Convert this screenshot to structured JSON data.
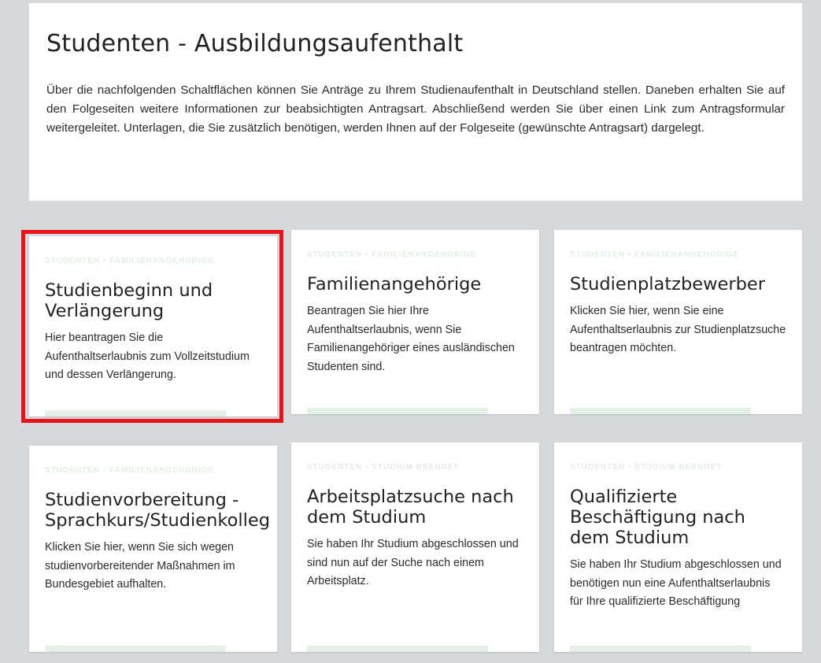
{
  "page": {
    "title": "Studenten - Ausbildungsaufenthalt",
    "intro": "Über die nachfolgenden Schaltflächen können Sie Anträge zu Ihrem Studienaufenthalt in Deutschland stellen. Daneben erhalten Sie auf den Folgeseiten weitere Informationen zur beabsichtigten Antragsart. Abschließend werden Sie über einen Link zum Antragsformular weitergeleitet. Unterlagen, die Sie zusätzlich benötigen, werden Ihnen auf der Folgeseite (gewünschte Antragsart) dargelegt."
  },
  "colors": {
    "page_background": "#d6d9dc",
    "card_background": "#ffffff",
    "highlight_border": "#e8141a",
    "card_accent": "#e6f1e6"
  },
  "cards": [
    {
      "category": "STUDENTEN • FAMILIENANGEHÖRIGE",
      "title": "Studienbeginn und Verlängerung",
      "text": "Hier beantragen Sie die Aufenthaltserlaubnis zum Vollzeitstudium und dessen Verlängerung.",
      "highlighted": true
    },
    {
      "category": "STUDENTEN • FAMILIENANGEHÖRIGE",
      "title": "Familienangehörige",
      "text": "Beantragen Sie hier Ihre Aufenthaltserlaubnis, wenn Sie Familienangehöriger eines ausländischen Studenten sind.",
      "highlighted": false
    },
    {
      "category": "STUDENTEN • FAMILIENANGEHÖRIGE",
      "title": "Studienplatzbewerber",
      "text": "Klicken Sie hier, wenn Sie eine Aufenthaltserlaubnis zur Studienplatzsuche beantragen möchten.",
      "highlighted": false
    },
    {
      "category": "STUDENTEN • FAMILIENANGEHÖRIGE",
      "title": "Studienvorbereitung - Sprachkurs/Studienkolleg",
      "text": "Klicken Sie hier, wenn Sie sich wegen studienvorbereitender Maßnahmen im Bundesgebiet aufhalten.",
      "highlighted": false
    },
    {
      "category": "STUDENTEN • STUDIUM BEENDET",
      "title": "Arbeitsplatzsuche nach dem Studium",
      "text": "Sie haben Ihr Studium abgeschlossen und sind nun auf der Suche nach einem Arbeitsplatz.",
      "highlighted": false
    },
    {
      "category": "STUDENTEN • STUDIUM BEENDET",
      "title": "Qualifizierte Beschäftigung nach dem Studium",
      "text": "Sie haben Ihr Studium abgeschlossen und benötigen nun eine Aufenthaltserlaubnis für Ihre qualifizierte Beschäftigung",
      "highlighted": false
    }
  ]
}
